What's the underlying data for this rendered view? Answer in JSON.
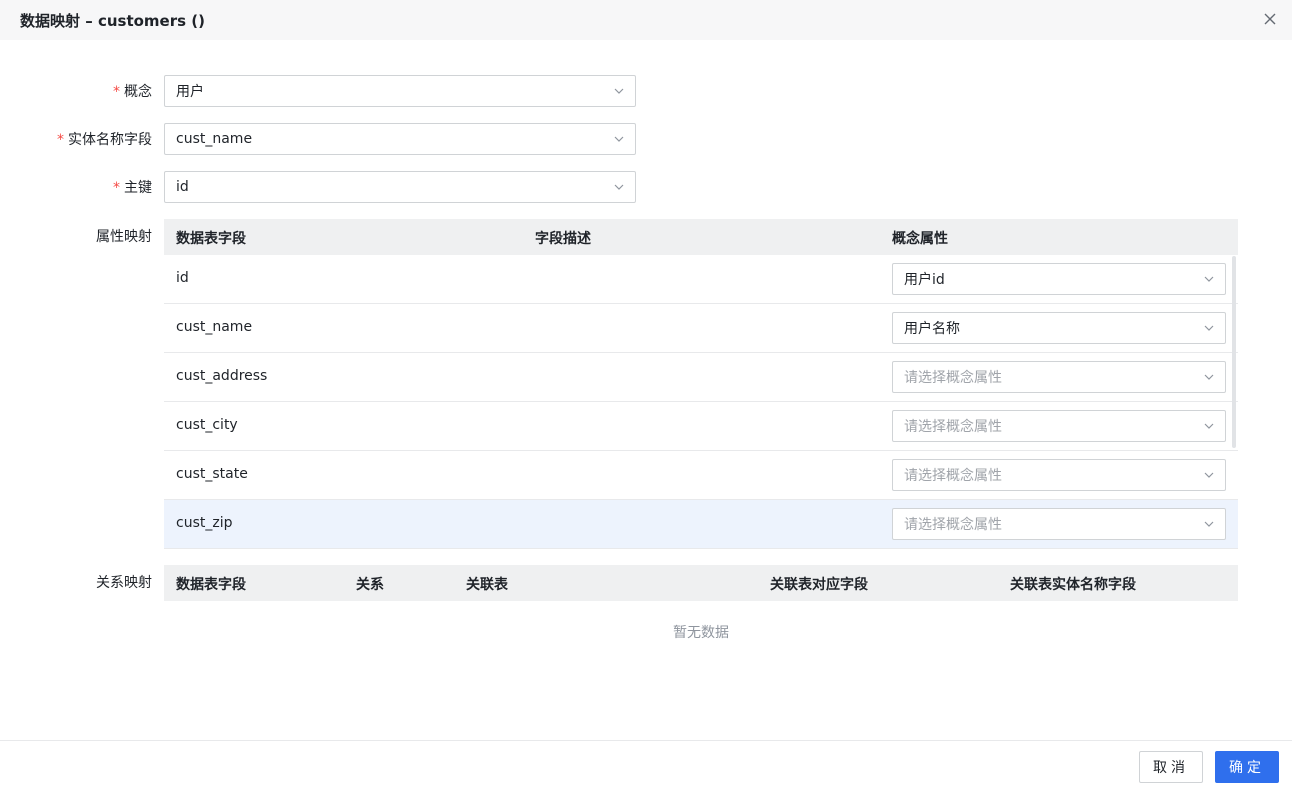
{
  "dialog": {
    "title": "数据映射 – customers ()"
  },
  "form": {
    "concept": {
      "label": "概念",
      "value": "用户"
    },
    "entity_name_field": {
      "label": "实体名称字段",
      "value": "cust_name"
    },
    "primary_key": {
      "label": "主键",
      "value": "id"
    },
    "required_mark": "*"
  },
  "attr_mapping": {
    "label": "属性映射",
    "columns": [
      "数据表字段",
      "字段描述",
      "概念属性"
    ],
    "rows": [
      {
        "field": "id",
        "desc": "",
        "attribute": "用户id",
        "placeholder": false
      },
      {
        "field": "cust_name",
        "desc": "",
        "attribute": "用户名称",
        "placeholder": false
      },
      {
        "field": "cust_address",
        "desc": "",
        "attribute": "请选择概念属性",
        "placeholder": true
      },
      {
        "field": "cust_city",
        "desc": "",
        "attribute": "请选择概念属性",
        "placeholder": true
      },
      {
        "field": "cust_state",
        "desc": "",
        "attribute": "请选择概念属性",
        "placeholder": true
      },
      {
        "field": "cust_zip",
        "desc": "",
        "attribute": "请选择概念属性",
        "placeholder": true
      }
    ],
    "highlighted_row_index": 5
  },
  "rel_mapping": {
    "label": "关系映射",
    "columns": [
      "数据表字段",
      "关系",
      "关联表",
      "关联表对应字段",
      "关联表实体名称字段"
    ],
    "empty_text": "暂无数据"
  },
  "footer": {
    "cancel_label": "取消",
    "ok_label": "确定"
  },
  "icons": {
    "close": "close-icon",
    "chevron": "chevron-down-icon"
  },
  "colors": {
    "primary": "#2f6fed",
    "required": "#f54a45",
    "row_highlight": "#edf3fd",
    "table_header": "#eff0f1"
  }
}
